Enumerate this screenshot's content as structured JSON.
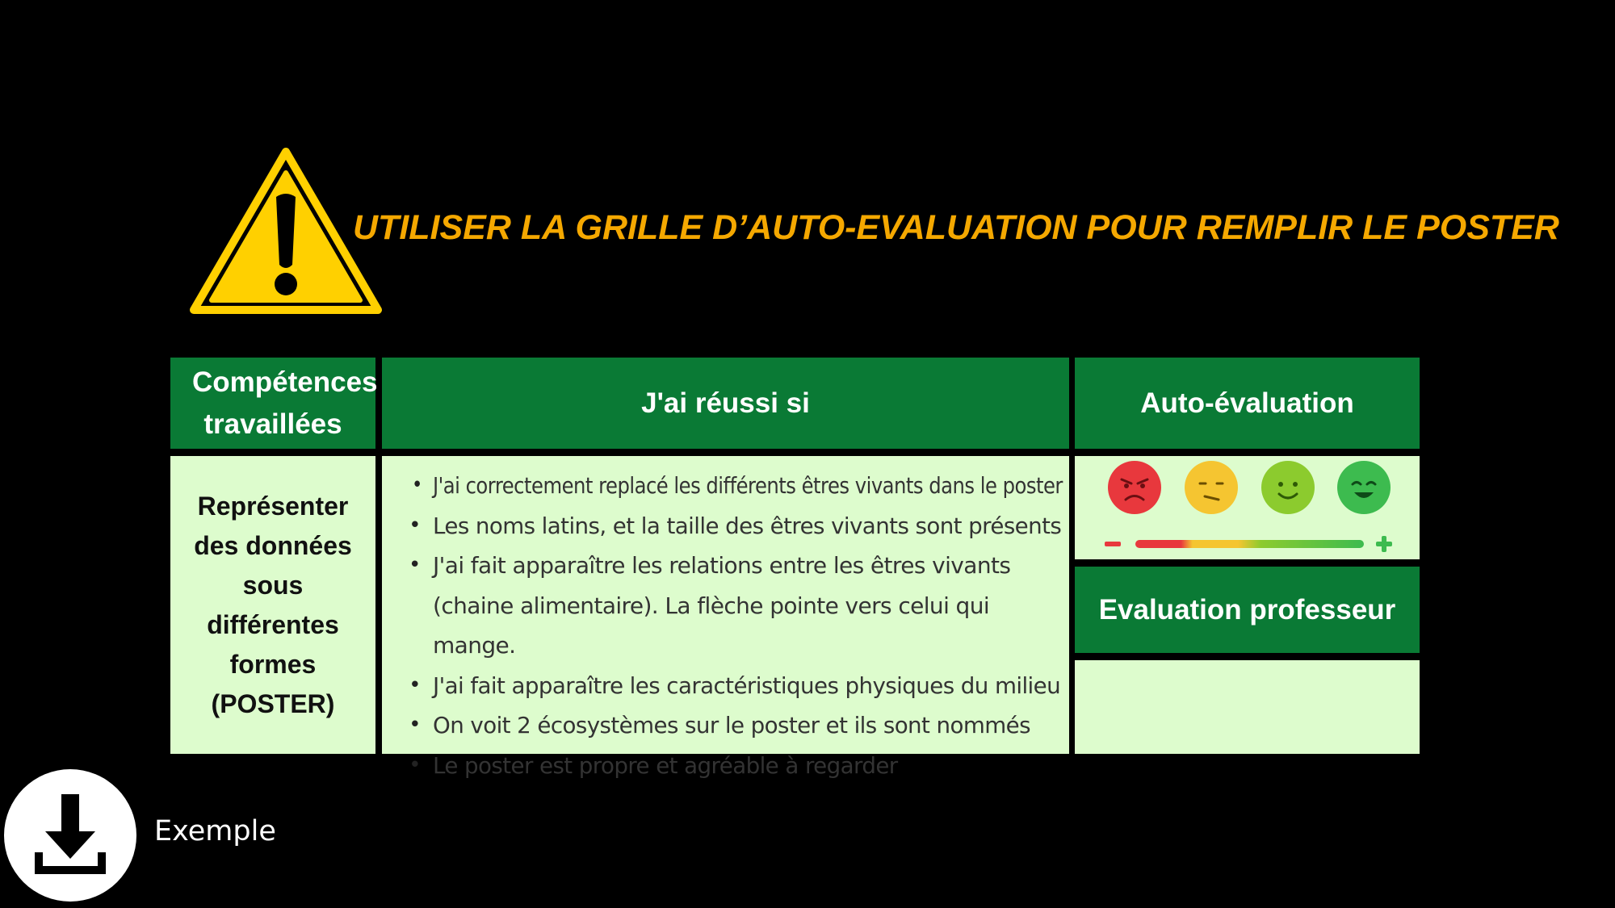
{
  "title": "UTILISER LA GRILLE D’AUTO-EVALUATION POUR REMPLIR LE POSTER",
  "colors": {
    "title": "#F5A800",
    "header_green": "#0A7A35",
    "cell_light_green": "#DDFCCD",
    "warning_yellow": "#FFD000"
  },
  "table": {
    "headers": {
      "competences": "Compétences travaillées",
      "criteria": "J'ai réussi si",
      "self_eval": "Auto-évaluation",
      "teacher_eval": "Evaluation professeur"
    },
    "competence": {
      "text_before": "Représenter des données sous différentes formes (",
      "bold": "POSTER",
      "text_after": ")"
    },
    "criteria": [
      "J'ai correctement replacé les différents êtres vivants dans le poster",
      "Les noms latins, et la taille des êtres vivants sont présents",
      "J'ai fait apparaître les relations entre les êtres vivants (chaine alimentaire). La flèche pointe vers celui qui mange.",
      "J'ai fait apparaître les caractéristiques physiques du milieu",
      "On voit 2 écosystèmes sur le poster et ils sont nommés",
      "Le poster est propre et agréable à regarder"
    ],
    "self_eval_faces": [
      {
        "icon": "angry-face-icon",
        "color": "#E8383D"
      },
      {
        "icon": "neutral-face-icon",
        "color": "#F5C531"
      },
      {
        "icon": "smiling-face-icon",
        "color": "#8CCB2E"
      },
      {
        "icon": "happy-face-icon",
        "color": "#3DBB4F"
      }
    ],
    "scale": {
      "minus": "−",
      "plus": "+"
    }
  },
  "download": {
    "icon": "download-icon",
    "label": "Exemple"
  }
}
